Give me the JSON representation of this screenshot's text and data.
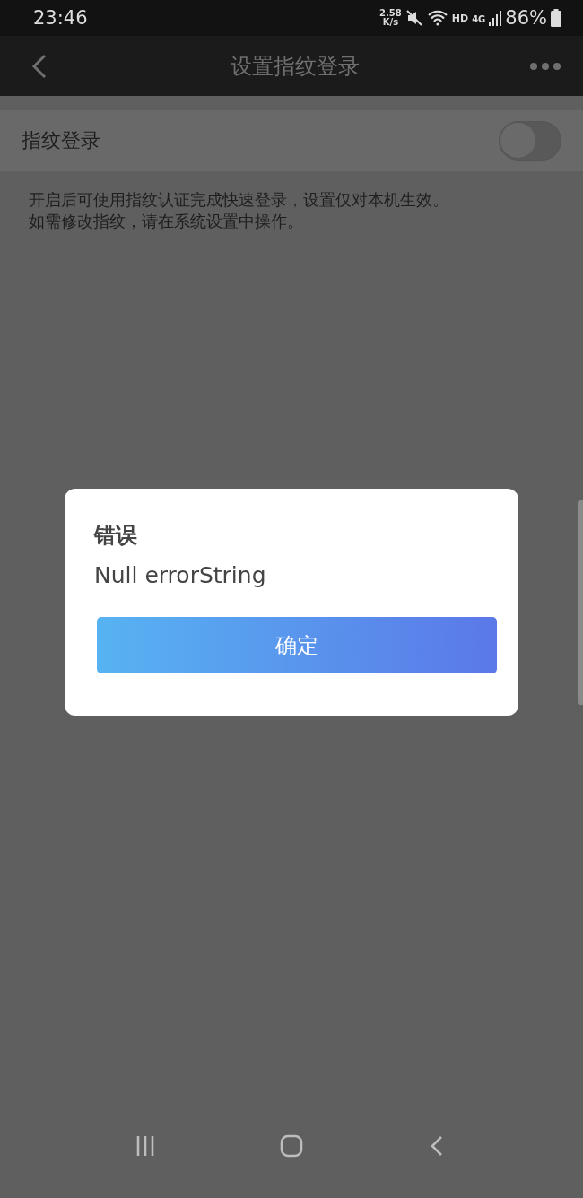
{
  "status_bar": {
    "time": "23:46",
    "net_speed": "2.58",
    "net_unit": "K/s",
    "hd": "HD",
    "network": "4G",
    "battery": "86%"
  },
  "header": {
    "title": "设置指纹登录"
  },
  "setting": {
    "label": "指纹登录",
    "on": false
  },
  "description": [
    "开启后可使用指纹认证完成快速登录，设置仅对本机生效。",
    "如需修改指纹，请在系统设置中操作。"
  ],
  "dialog": {
    "title": "错误",
    "message": "Null errorString",
    "button": "确定"
  }
}
